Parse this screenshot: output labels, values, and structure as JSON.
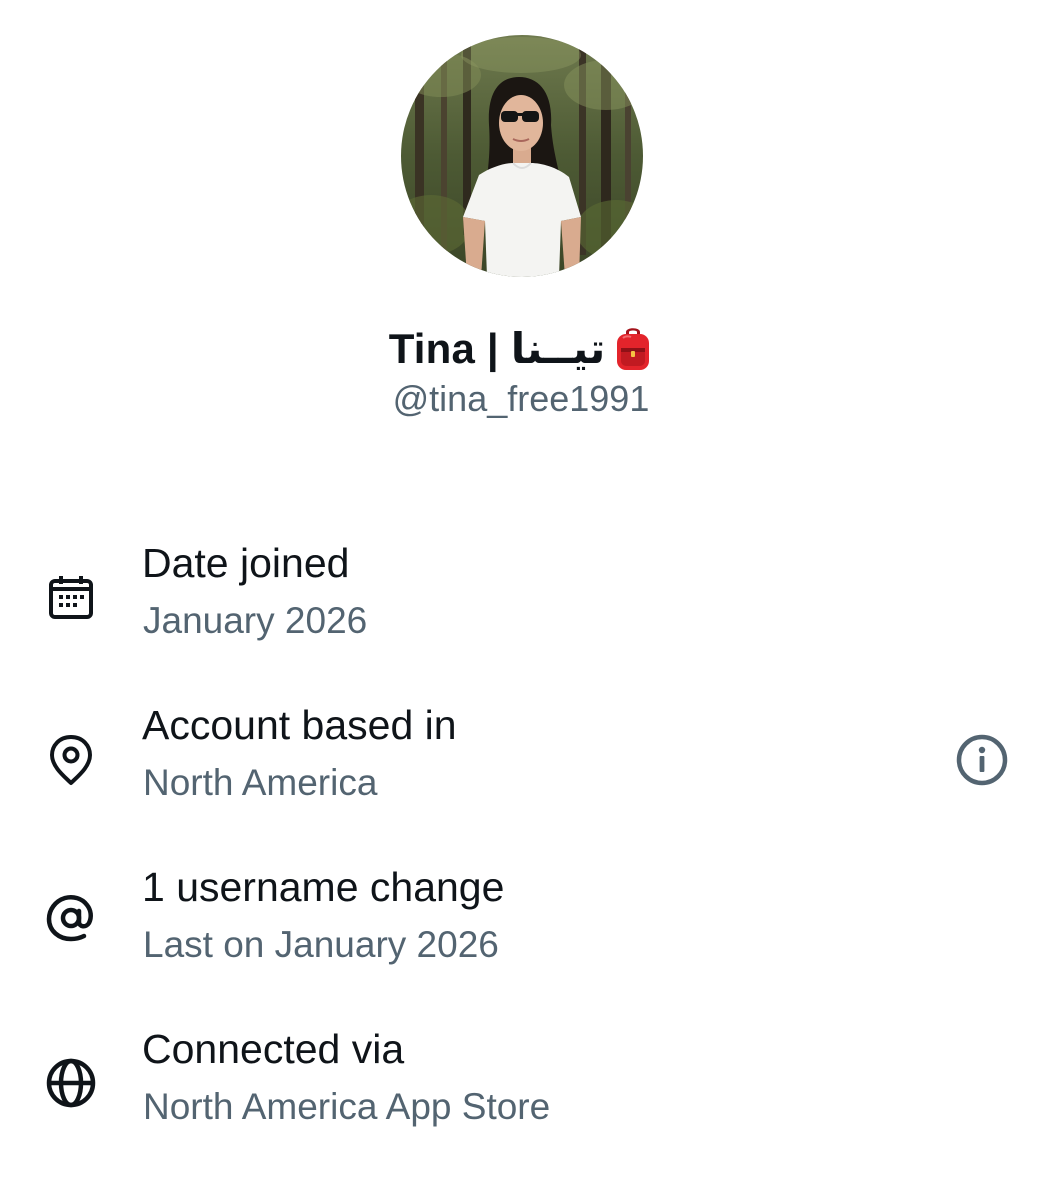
{
  "profile": {
    "display_name": "Tina | تيــنا",
    "display_emoji_icon": "backpack-icon",
    "handle": "@tina_free1991",
    "avatar_icon": "profile-photo"
  },
  "rows": [
    {
      "icon": "calendar-icon",
      "title": "Date joined",
      "subtitle": "January 2026"
    },
    {
      "icon": "location-pin-icon",
      "title": "Account based in",
      "subtitle": "North America",
      "action_icon": "info-icon"
    },
    {
      "icon": "at-sign-icon",
      "title": "1 username change",
      "subtitle": "Last on January 2026"
    },
    {
      "icon": "globe-icon",
      "title": "Connected via",
      "subtitle": "North America App Store"
    }
  ],
  "colors": {
    "primary_text": "#0f1419",
    "secondary_text": "#536471",
    "background": "#ffffff"
  }
}
